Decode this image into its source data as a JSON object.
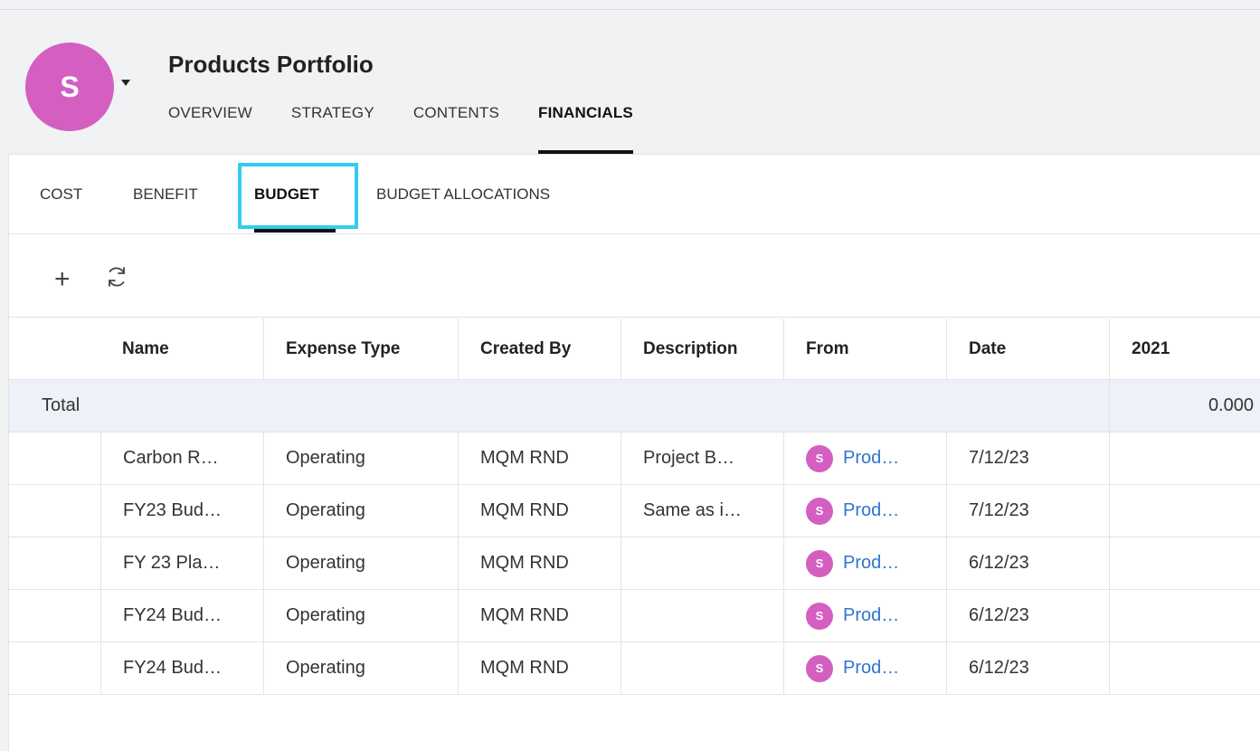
{
  "header": {
    "avatar_letter": "S",
    "title": "Products Portfolio",
    "tabs": [
      {
        "label": "OVERVIEW"
      },
      {
        "label": "STRATEGY"
      },
      {
        "label": "CONTENTS"
      },
      {
        "label": "FINANCIALS",
        "active": true
      }
    ]
  },
  "sub_tabs": [
    {
      "label": "COST"
    },
    {
      "label": "BENEFIT"
    },
    {
      "label": "BUDGET",
      "active": true
    },
    {
      "label": "BUDGET ALLOCATIONS"
    }
  ],
  "toolbar": {
    "add_icon": "plus-icon",
    "refresh_icon": "refresh-icon",
    "add_glyph": "+"
  },
  "table": {
    "columns": [
      "Name",
      "Expense Type",
      "Created By",
      "Description",
      "From",
      "Date",
      "2021"
    ],
    "total": {
      "label": "Total",
      "value_2021": "0.000"
    },
    "rows": [
      {
        "name": "Carbon R…",
        "expense_type": "Operating",
        "created_by": "MQM RND",
        "description": "Project B…",
        "from_avatar": "S",
        "from": "Prod…",
        "date": "7/12/23"
      },
      {
        "name": "FY23 Bud…",
        "expense_type": "Operating",
        "created_by": "MQM RND",
        "description": "Same as i…",
        "from_avatar": "S",
        "from": "Prod…",
        "date": "7/12/23"
      },
      {
        "name": "FY 23 Pla…",
        "expense_type": "Operating",
        "created_by": "MQM RND",
        "description": "",
        "from_avatar": "S",
        "from": "Prod…",
        "date": "6/12/23"
      },
      {
        "name": "FY24 Bud…",
        "expense_type": "Operating",
        "created_by": "MQM RND",
        "description": "",
        "from_avatar": "S",
        "from": "Prod…",
        "date": "6/12/23"
      },
      {
        "name": "FY24 Bud…",
        "expense_type": "Operating",
        "created_by": "MQM RND",
        "description": "",
        "from_avatar": "S",
        "from": "Prod…",
        "date": "6/12/23"
      }
    ]
  },
  "colors": {
    "avatar": "#d45fc1",
    "highlight": "#33ccee",
    "link": "#2f74d0",
    "total_row_bg": "#edf2f8"
  }
}
